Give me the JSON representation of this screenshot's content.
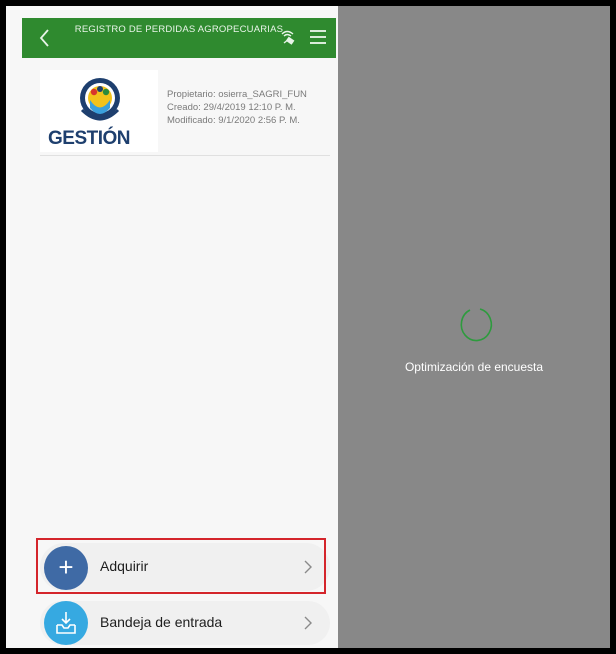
{
  "header": {
    "title": "REGISTRO DE PERDIDAS AGROPECUARIAS",
    "back_icon": "chevron-left-icon",
    "satellite_icon": "satellite-icon",
    "menu_icon": "hamburger-menu-icon"
  },
  "survey": {
    "logo_text": "GESTIÓN",
    "owner": "Propietario: osierra_SAGRI_FUN",
    "created": "Creado: 29/4/2019 12:10 P. M.",
    "modified": "Modificado: 9/1/2020 2:56 P. M."
  },
  "actions": [
    {
      "label": "Adquirir",
      "icon": "plus-icon"
    },
    {
      "label": "Bandeja de entrada",
      "icon": "inbox-download-icon"
    }
  ],
  "overlay": {
    "status": "Optimización de encuesta",
    "spinner_icon": "loading-spinner-icon"
  },
  "colors": {
    "header_green": "#2f8a2f",
    "adquirir_blue": "#3f6aa5",
    "inbox_blue": "#36a9e1",
    "overlay_gray": "#888888",
    "highlight_red": "#d4252b",
    "spinner_green": "#2e9b3e"
  }
}
